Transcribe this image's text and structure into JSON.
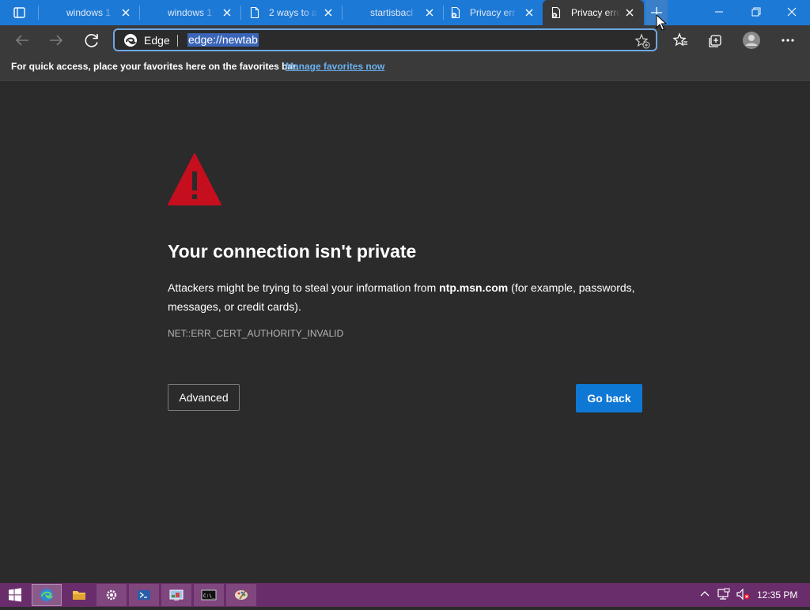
{
  "tabs": [
    {
      "label": "windows 1",
      "icon": "blank-page-icon",
      "active": false
    },
    {
      "label": "windows 1",
      "icon": "blank-page-icon",
      "active": false
    },
    {
      "label": "2 ways to a",
      "icon": "document-icon",
      "active": false
    },
    {
      "label": "startisbacl",
      "icon": "blank-page-icon",
      "active": false
    },
    {
      "label": "Privacy err",
      "icon": "document-error-icon",
      "active": false
    },
    {
      "label": "Privacy erro",
      "icon": "document-error-icon",
      "active": true
    }
  ],
  "address_bar": {
    "edge_label": "Edge",
    "url": "edge://newtab"
  },
  "favorites_bar": {
    "message": "For quick access, place your favorites here on the favorites bar.",
    "link": "Manage favorites now"
  },
  "error_page": {
    "title": "Your connection isn't private",
    "description_prefix": "Attackers might be trying to steal your information from",
    "domain": "ntp.msn.com",
    "description_suffix": "(for example, passwords, messages, or credit cards).",
    "error_code": "NET::ERR_CERT_AUTHORITY_INVALID",
    "advanced_button": "Advanced",
    "go_back_button": "Go back"
  },
  "taskbar": {
    "time": "12:35 PM",
    "apps": [
      "windows-start-icon",
      "edge-icon",
      "file-explorer-icon",
      "settings-icon",
      "powershell-icon",
      "control-panel-icon",
      "command-prompt-icon",
      "paint-icon"
    ]
  },
  "colors": {
    "tab_bar": "#1d79d6",
    "toolbar": "#3a3a3a",
    "page_background": "#2b2b2b",
    "warning_red": "#c50f1f",
    "primary_button": "#0e78d4",
    "taskbar": "#6a2d6b",
    "link": "#6cb0f0"
  }
}
